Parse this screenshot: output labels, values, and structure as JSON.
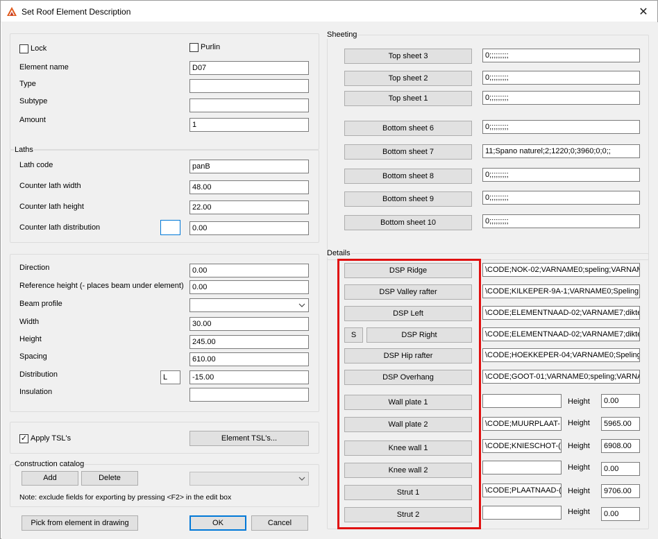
{
  "window": {
    "title": "Set Roof Element Description",
    "close_glyph": "✕",
    "accent": "#0078d7",
    "highlight_color": "#e01010"
  },
  "general": {
    "lock_label": "Lock",
    "lock_checked": false,
    "purlin_label": "Purlin",
    "purlin_checked": false,
    "element_name_label": "Element name",
    "element_name_value": "D07",
    "type_label": "Type",
    "type_value": "",
    "subtype_label": "Subtype",
    "subtype_value": "",
    "amount_label": "Amount",
    "amount_value": "1"
  },
  "laths": {
    "title": "Laths",
    "lath_code_label": "Lath code",
    "lath_code_value": "panB",
    "counter_lath_width_label": "Counter lath width",
    "counter_lath_width_value": "48.00",
    "counter_lath_height_label": "Counter lath height",
    "counter_lath_height_value": "22.00",
    "counter_lath_distribution_label": "Counter lath distribution",
    "counter_lath_distribution_code": "",
    "counter_lath_distribution_value": "0.00"
  },
  "beam": {
    "direction_label": "Direction",
    "direction_value": "0.00",
    "reference_height_label": "Reference height (- places beam under element)",
    "reference_height_value": "0.00",
    "beam_profile_label": "Beam profile",
    "beam_profile_value": "",
    "width_label": "Width",
    "width_value": "30.00",
    "height_label": "Height",
    "height_value": "245.00",
    "spacing_label": "Spacing",
    "spacing_value": "610.00",
    "distribution_label": "Distribution",
    "distribution_code": "L",
    "distribution_value": "-15.00",
    "insulation_label": "Insulation",
    "insulation_value": ""
  },
  "tsl": {
    "apply_label": "Apply TSL's",
    "apply_checked": true,
    "element_tsls_button": "Element TSL's..."
  },
  "catalog": {
    "title": "Construction catalog",
    "add_button": "Add",
    "delete_button": "Delete",
    "selected": "",
    "note": "Note: exclude fields for exporting by pressing <F2> in the edit box"
  },
  "footer": {
    "pick_button": "Pick from element in drawing",
    "ok_button": "OK",
    "cancel_button": "Cancel"
  },
  "sheeting": {
    "title": "Sheeting",
    "rows": [
      {
        "label": "Top sheet 3",
        "value": "0;;;;;;;;;"
      },
      {
        "label": "Top sheet 2",
        "value": "0;;;;;;;;;"
      },
      {
        "label": "Top sheet 1",
        "value": "0;;;;;;;;;"
      },
      {
        "label": "Bottom sheet 6",
        "value": "0;;;;;;;;;"
      },
      {
        "label": "Bottom sheet 7",
        "value": "11;Spano naturel;2;1220;0;3960;0;0;;"
      },
      {
        "label": "Bottom sheet 8",
        "value": "0;;;;;;;;;"
      },
      {
        "label": "Bottom sheet 9",
        "value": "0;;;;;;;;;"
      },
      {
        "label": "Bottom sheet 10",
        "value": "0;;;;;;;;;"
      }
    ]
  },
  "details": {
    "title": "Details",
    "s_button": "S",
    "rows": [
      {
        "label": "DSP Ridge",
        "value": "\\CODE;NOK-02;VARNAME0;speling;VARNAM"
      },
      {
        "label": "DSP Valley rafter",
        "value": "\\CODE;KILKEPER-9A-1;VARNAME0;Speling;\\"
      },
      {
        "label": "DSP Left",
        "value": "\\CODE;ELEMENTNAAD-02;VARNAME7;dikte"
      },
      {
        "label": "DSP Right",
        "value": "\\CODE;ELEMENTNAAD-02;VARNAME7;dikte"
      },
      {
        "label": "DSP Hip rafter",
        "value": "\\CODE;HOEKKEPER-04;VARNAME0;Speling;"
      },
      {
        "label": "DSP Overhang",
        "value": "\\CODE;GOOT-01;VARNAME0;speling;VARNA"
      }
    ],
    "height_label": "Height",
    "height_rows": [
      {
        "label": "Wall plate 1",
        "value": "",
        "height": "0.00"
      },
      {
        "label": "Wall plate 2",
        "value": "\\CODE;MUURPLAAT-",
        "height": "5965.00"
      },
      {
        "label": "Knee wall 1",
        "value": "\\CODE;KNIESCHOT-(",
        "height": "6908.00"
      },
      {
        "label": "Knee wall 2",
        "value": "",
        "height": "0.00"
      },
      {
        "label": "Strut 1",
        "value": "\\CODE;PLAATNAAD-(",
        "height": "9706.00"
      },
      {
        "label": "Strut 2",
        "value": "",
        "height": "0.00"
      }
    ]
  }
}
